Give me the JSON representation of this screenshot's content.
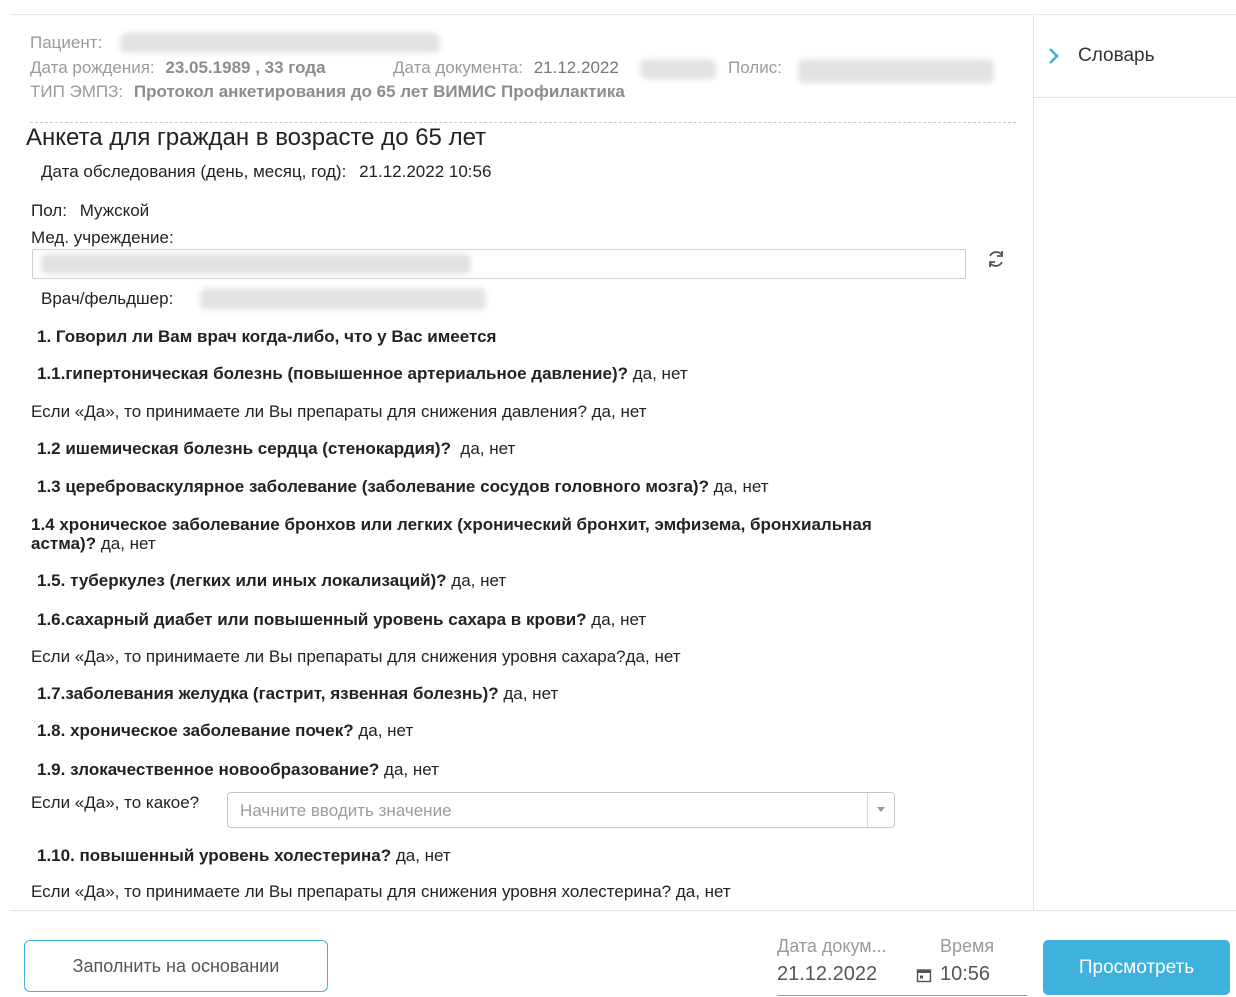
{
  "header": {
    "patient_label": "Пациент:",
    "dob_label": "Дата рождения:",
    "dob_value": "23.05.1989 , 33 года",
    "docdate_label": "Дата документа:",
    "docdate_value": "21.12.2022",
    "policy_label": "Полис:",
    "type_label": "ТИП ЭМПЗ:",
    "type_value": "Протокол анкетирования до 65 лет ВИМИС Профилактика"
  },
  "sidebar": {
    "dictionary_label": "Словарь"
  },
  "form": {
    "title": "Анкета для граждан в возрасте до 65 лет",
    "exam_date_label": "Дата обследования (день, месяц, год):",
    "exam_date_value": "21.12.2022 10:56",
    "sex_label": "Пол:",
    "sex_value": "Мужской",
    "institution_label": "Мед. учреждение:",
    "doctor_label": "Врач/фельдшер:",
    "q1": "1. Говорил ли Вам врач когда-либо, что у Вас имеется",
    "q1_1_bold": "1.1.гипертоническая болезнь (повышенное артериальное давление)?",
    "q1_1_ans": " да, нет",
    "q1_1_sub": "Если «Да», то принимаете ли Вы препараты для снижения давления? да, нет",
    "q1_2_bold": "1.2 ишемическая болезнь сердца (стенокардия)?",
    "q1_2_ans": "  да, нет",
    "q1_3_bold": "1.3 цереброваскулярное заболевание (заболевание сосудов головного мозга)?",
    "q1_3_ans": " да, нет",
    "q1_4_bold_a": "1.4 хроническое заболевание бронхов или легких (хронический бронхит, эмфизема, бронхиальная",
    "q1_4_bold_b": "астма)?",
    "q1_4_ans": " да, нет",
    "q1_5_bold": "1.5. туберкулез (легких или иных локализаций)?",
    "q1_5_ans": " да, нет",
    "q1_6_bold": "1.6.сахарный диабет или повышенный уровень сахара в крови?",
    "q1_6_ans": " да, нет",
    "q1_6_sub": "Если «Да», то принимаете ли Вы препараты для снижения уровня сахара?да, нет",
    "q1_7_bold": "1.7.заболевания желудка (гастрит, язвенная болезнь)?",
    "q1_7_ans": " да, нет",
    "q1_8_bold": "1.8. хроническое заболевание почек?",
    "q1_8_ans": " да, нет",
    "q1_9_bold": "1.9. злокачественное новообразование?",
    "q1_9_ans": " да, нет",
    "q1_9_sub_label": "Если «Да», то какое?",
    "q1_9_placeholder": "Начните вводить значение",
    "q1_10_bold": "1.10. повышенный уровень холестерина?",
    "q1_10_ans": " да, нет",
    "q1_10_sub": "Если «Да», то принимаете ли Вы препараты для снижения уровня холестерина? да, нет"
  },
  "footer": {
    "fill_button": "Заполнить на основании",
    "doc_date_label": "Дата докум...",
    "doc_date_value": "21.12.2022",
    "time_label": "Время",
    "time_value": "10:56",
    "view_button": "Просмотреть"
  },
  "colors": {
    "accent": "#3eb1dd"
  }
}
